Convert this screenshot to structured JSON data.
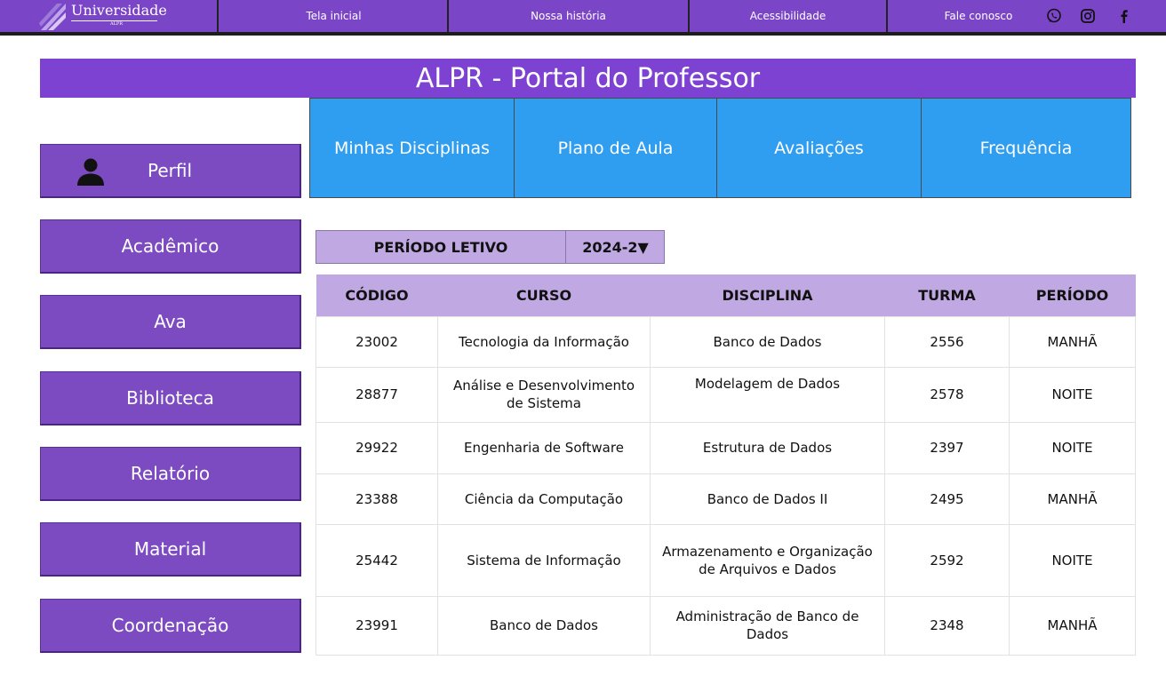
{
  "colors": {
    "nav_bg": "#7b45c8",
    "banner_bg": "#7d42d2",
    "sidebar_bg": "#7c4bc2",
    "tab_bg": "#2f9df0",
    "table_header_bg": "#c0a9e3"
  },
  "topnav": {
    "logo_text": "Universidade",
    "logo_sub": "ALPR",
    "links": [
      "Tela inicial",
      "Nossa história",
      "Acessibilidade",
      "Fale conosco"
    ],
    "icons": [
      "whatsapp-icon",
      "instagram-icon",
      "facebook-icon"
    ]
  },
  "banner": {
    "title": "ALPR - Portal do Professor"
  },
  "sidebar": {
    "profile_icon": "user-icon",
    "items": [
      "Perfil",
      "Acadêmico",
      "Ava",
      "Biblioteca",
      "Relatório",
      "Material",
      "Coordenação"
    ]
  },
  "tabs": [
    "Minhas Disciplinas",
    "Plano de Aula",
    "Avaliações",
    "Frequência"
  ],
  "periodo": {
    "label": "PERÍODO LETIVO",
    "value": "2024-2▼"
  },
  "table": {
    "headers": [
      "CÓDIGO",
      "CURSO",
      "DISCIPLINA",
      "TURMA",
      "PERÍODO"
    ],
    "rows": [
      [
        "23002",
        "Tecnologia da Informação",
        "Banco de Dados",
        "2556",
        "MANHÃ"
      ],
      [
        "28877",
        "Análise e Desenvolvimento de Sistema",
        "Modelagem de Dados",
        "2578",
        "NOITE"
      ],
      [
        "29922",
        "Engenharia de Software",
        "Estrutura de Dados",
        "2397",
        "NOITE"
      ],
      [
        "23388",
        "Ciência da Computação",
        "Banco de Dados II",
        "2495",
        "MANHÃ"
      ],
      [
        "25442",
        "Sistema de Informação",
        "Armazenamento e Organização de Arquivos e Dados",
        "2592",
        "NOITE"
      ],
      [
        "23991",
        "Banco de Dados",
        "Administração de Banco de Dados",
        "2348",
        "MANHÃ"
      ]
    ]
  }
}
